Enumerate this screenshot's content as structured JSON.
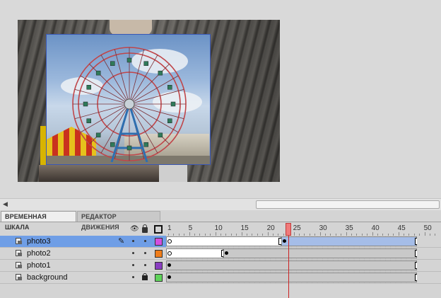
{
  "tabs": [
    {
      "label": "ВРЕМЕННАЯ ШКАЛА",
      "active": true
    },
    {
      "label": "РЕДАКТОР ДВИЖЕНИЯ",
      "active": false
    }
  ],
  "header_icons": [
    "eye-icon",
    "lock-icon",
    "outline-icon"
  ],
  "ruler": {
    "labels": [
      "1",
      "5",
      "10",
      "15",
      "20",
      "25",
      "30",
      "35",
      "40",
      "45",
      "50"
    ],
    "current_frame": 24
  },
  "layers": [
    {
      "name": "photo3",
      "selected": true,
      "color": "#d34fe0",
      "locked": false
    },
    {
      "name": "photo2",
      "selected": false,
      "color": "#f07d1a",
      "locked": false
    },
    {
      "name": "photo1",
      "selected": false,
      "color": "#8a3fc2",
      "locked": false
    },
    {
      "name": "background",
      "selected": false,
      "color": "#5fd35a",
      "locked": true
    }
  ],
  "colors": {
    "selection": "#6f9ee6",
    "playhead": "#cc2222",
    "stage_border": "#3a57b5"
  }
}
